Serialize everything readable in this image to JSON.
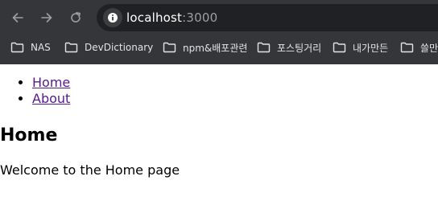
{
  "browser": {
    "address": {
      "host": "localhost",
      "port": ":3000"
    },
    "bookmarks": [
      "NAS",
      "DevDictionary",
      "npm&배포관련",
      "포스팅거리",
      "내가만든",
      "쓸만"
    ]
  },
  "page": {
    "nav": [
      "Home",
      "About"
    ],
    "heading": "Home",
    "text": "Welcome to the Home page"
  },
  "colors": {
    "chrome_bg": "#35363a",
    "omnibox_bg": "#202124",
    "visited_link": "#551a8b"
  }
}
